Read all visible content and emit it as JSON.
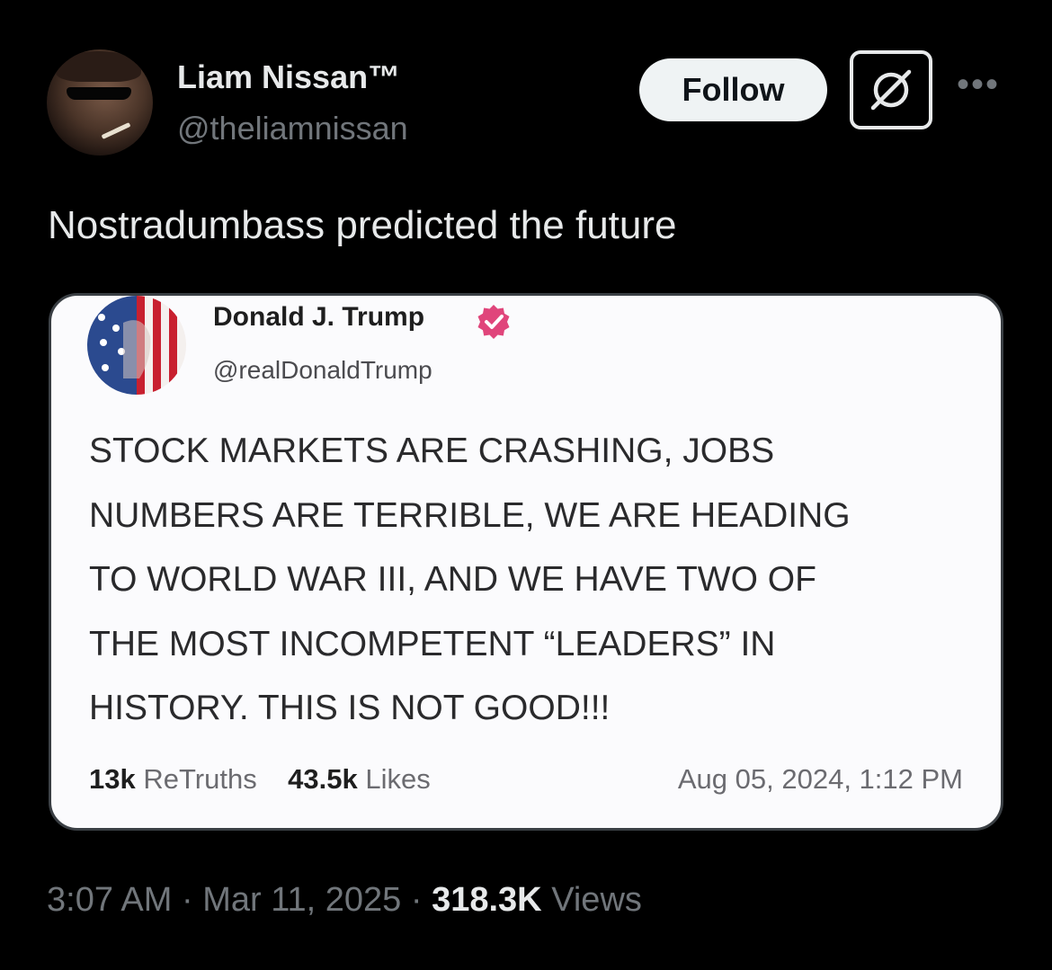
{
  "author": {
    "display_name": "Liam Nissan™",
    "handle": "@theliamnissan"
  },
  "actions": {
    "follow_label": "Follow",
    "grok_icon": "grok-icon",
    "more_icon": "more-icon",
    "more_glyph": "•••"
  },
  "tweet": {
    "text": "Nostradumbass predicted the future"
  },
  "quoted_image": {
    "name": "Donald J. Trump",
    "handle": "@realDonaldTrump",
    "body": "STOCK MARKETS ARE CRASHING, JOBS\nNUMBERS ARE TERRIBLE, WE ARE HEADING\nTO WORLD WAR III, AND WE HAVE TWO OF\nTHE MOST INCOMPETENT “LEADERS” IN\nHISTORY. THIS IS NOT GOOD!!!",
    "retruths_count": "13k",
    "retruths_label": "ReTruths",
    "likes_count": "43.5k",
    "likes_label": "Likes",
    "date": "Aug 05, 2024, 1:12 PM",
    "verified_color": "#e0457b"
  },
  "meta": {
    "time": "3:07 AM",
    "sep1": "·",
    "date": "Mar 11, 2025",
    "sep2": "·",
    "views_count": "318.3K",
    "views_label": "Views"
  },
  "colors": {
    "background": "#000000",
    "text_primary": "#e7e9ea",
    "text_secondary": "#71767b",
    "follow_bg": "#eff3f4"
  }
}
